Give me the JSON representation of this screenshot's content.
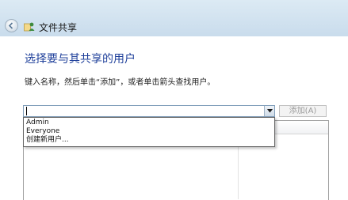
{
  "window": {
    "title": "文件共享"
  },
  "heading": "选择要与其共享的用户",
  "instruction": "键入名称，然后单击“添加”，或者单击箭头查找用户。",
  "combo": {
    "value": ""
  },
  "add_button": {
    "label": "添加(A)",
    "enabled": false
  },
  "dropdown": {
    "options": [
      "Admin",
      "Everyone",
      "创建新用户..."
    ]
  },
  "users_list": {
    "rows": []
  },
  "colors": {
    "heading": "#1e3f9a",
    "titlebar": "#c9dcec"
  },
  "icons": {
    "back": "back-arrow-icon",
    "title": "share-users-icon",
    "dropdown": "chevron-down-icon"
  }
}
